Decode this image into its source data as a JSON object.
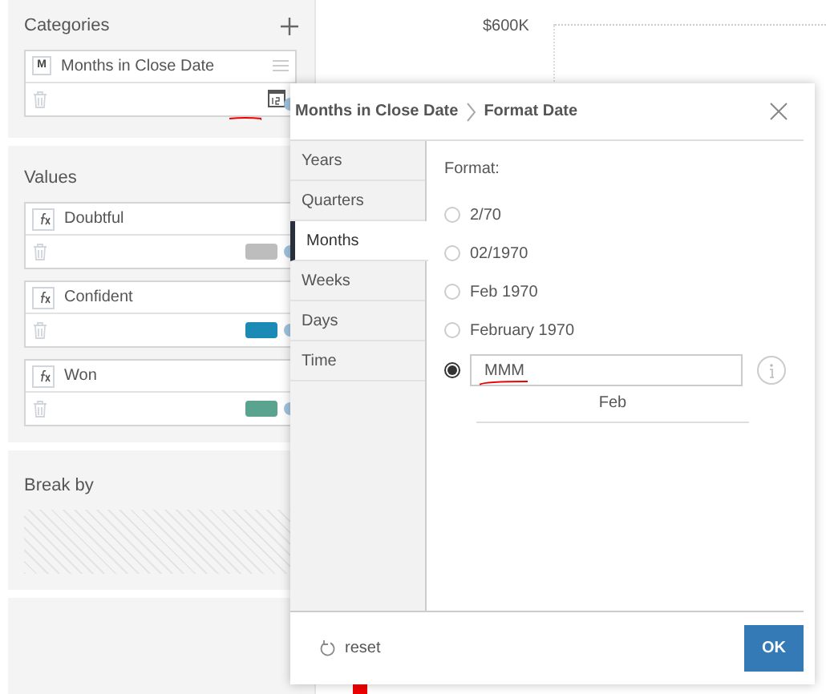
{
  "categories": {
    "title": "Categories",
    "items": [
      {
        "badge": "M",
        "label": "Months in Close Date"
      }
    ]
  },
  "values": {
    "title": "Values",
    "items": [
      {
        "label": "Doubtful",
        "color": "#bdbdbd"
      },
      {
        "label": "Confident",
        "color": "#1b8ab4"
      },
      {
        "label": "Won",
        "color": "#5aa38e"
      }
    ]
  },
  "break_by": {
    "title": "Break by"
  },
  "chart": {
    "axis_label": "$600K"
  },
  "dialog": {
    "breadcrumb": [
      "Months in Close Date",
      "Format Date"
    ],
    "tabs": [
      {
        "label": "Years",
        "selected": false
      },
      {
        "label": "Quarters",
        "selected": false
      },
      {
        "label": "Months",
        "selected": true
      },
      {
        "label": "Weeks",
        "selected": false
      },
      {
        "label": "Days",
        "selected": false
      },
      {
        "label": "Time",
        "selected": false
      }
    ],
    "format_label": "Format:",
    "options": [
      {
        "kind": "preset",
        "label": "2/70",
        "selected": false
      },
      {
        "kind": "preset",
        "label": "02/1970",
        "selected": false
      },
      {
        "kind": "preset",
        "label": "Feb 1970",
        "selected": false
      },
      {
        "kind": "preset",
        "label": "February 1970",
        "selected": false
      },
      {
        "kind": "custom",
        "value": "MMM",
        "selected": true
      }
    ],
    "preview": "Feb",
    "reset": "reset",
    "ok": "OK"
  }
}
